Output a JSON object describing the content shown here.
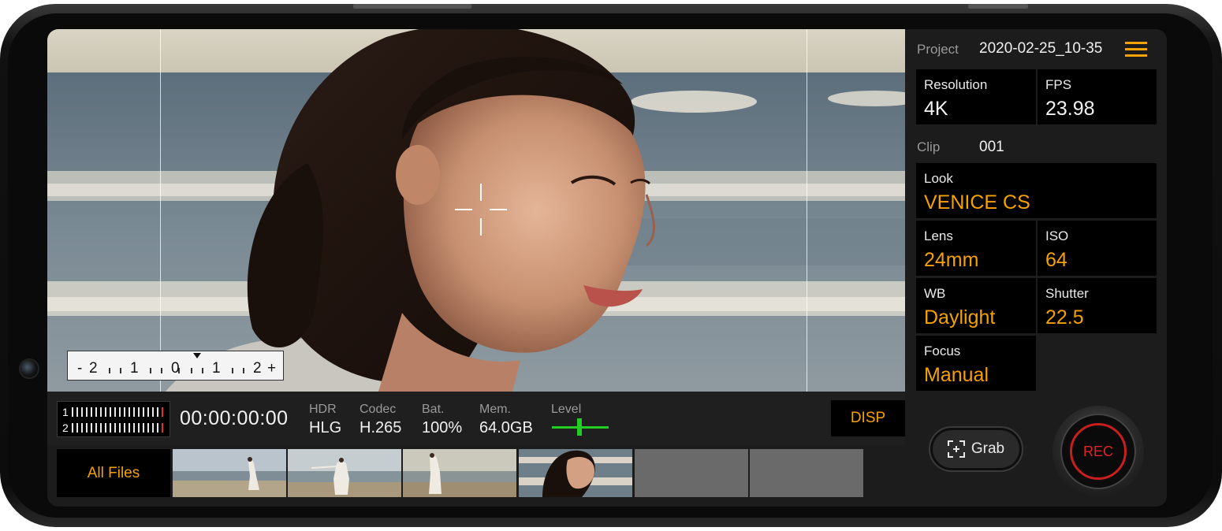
{
  "project": {
    "label": "Project",
    "value": "2020-02-25_10-35"
  },
  "clip": {
    "label": "Clip",
    "value": "001"
  },
  "settings": {
    "resolution": {
      "label": "Resolution",
      "value": "4K"
    },
    "fps": {
      "label": "FPS",
      "value": "23.98"
    },
    "look": {
      "label": "Look",
      "value": "VENICE CS"
    },
    "lens": {
      "label": "Lens",
      "value": "24mm"
    },
    "iso": {
      "label": "ISO",
      "value": "64"
    },
    "wb": {
      "label": "WB",
      "value": "Daylight"
    },
    "shutter": {
      "label": "Shutter",
      "value": "22.5"
    },
    "focus": {
      "label": "Focus",
      "value": "Manual"
    }
  },
  "exposure_scale": {
    "labels": [
      "-",
      "2",
      "1",
      "0",
      "1",
      "2",
      "+"
    ],
    "value": 0
  },
  "audio": {
    "channels": [
      "1",
      "2"
    ]
  },
  "timecode": "00:00:00:00",
  "status": {
    "hdr": {
      "label": "HDR",
      "value": "HLG"
    },
    "codec": {
      "label": "Codec",
      "value": "H.265"
    },
    "battery": {
      "label": "Bat.",
      "value": "100%"
    },
    "memory": {
      "label": "Mem.",
      "value": "64.0GB"
    },
    "level": {
      "label": "Level"
    }
  },
  "buttons": {
    "disp": "DISP",
    "all_files": "All Files",
    "grab": "Grab",
    "rec": "REC"
  },
  "icons": {
    "menu": "hamburger-menu-icon",
    "grab": "grab-frame-icon",
    "crosshair": "focus-crosshair-icon"
  },
  "colors": {
    "accent": "#f5a200",
    "rec": "#e02424",
    "level": "#22cc22",
    "panel_bg": "#1c1c1c",
    "cell_bg": "#000000"
  }
}
